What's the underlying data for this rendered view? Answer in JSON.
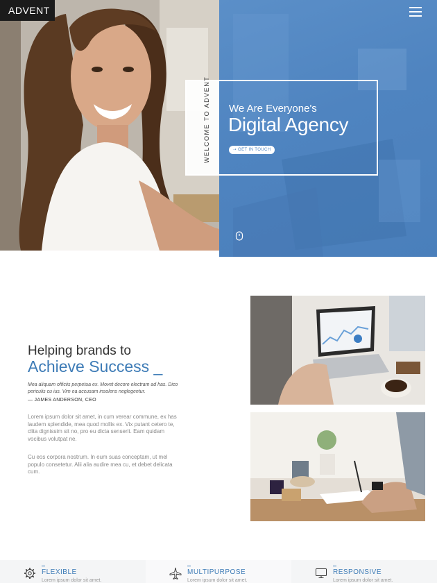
{
  "header": {
    "logo": "ADVENT"
  },
  "hero": {
    "vertical_text": "WELCOME TO ADVENT",
    "subtitle": "We Are Everyone's",
    "title": "Digital Agency",
    "cta_label": "➝ GET IN TOUCH"
  },
  "about": {
    "heading_line1": "Helping brands to",
    "heading_line2": "Achieve Success _",
    "quote": "Mea aliquam officiis perpetua ex. Movet decore electram ad has. Dico periculis cu ius. Vim ea accusam insolens neglegentur.",
    "author": "— JAMES ANDERSON, CEO",
    "paragraph1": "Lorem ipsum dolor sit amet, in cum verear commune, ex has laudem splendide, mea quod mollis ex. Vix putant cetero te, clita dignissim sit no, pro eu dicta senserit. Eam quidam vocibus volutpat ne.",
    "paragraph2": "Cu eos corpora nostrum. In eum suas conceptam, ut mel populo consetetur. Alii alia audire mea cu, et debet delicata cum."
  },
  "features": [
    {
      "icon": "gear-icon",
      "title": "FLEXIBLE",
      "text": "Lorem ipsum dolor sit amet."
    },
    {
      "icon": "plane-icon",
      "title": "MULTIPURPOSE",
      "text": "Lorem ipsum dolor sit amet."
    },
    {
      "icon": "monitor-icon",
      "title": "RESPONSIVE",
      "text": "Lorem ipsum dolor sit amet."
    }
  ],
  "colors": {
    "accent": "#3d7bb6",
    "hero_blue": "#4f84c0",
    "logo_bg": "#1b1b1b"
  }
}
